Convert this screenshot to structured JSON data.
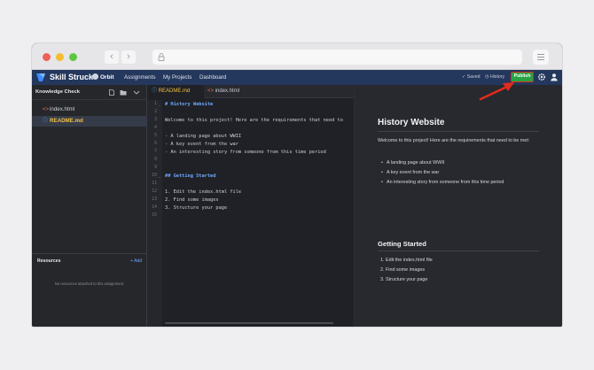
{
  "app": {
    "brand": "Skill Struck",
    "product": "Orbit",
    "nav": [
      "Assignments",
      "My Projects",
      "Dashboard"
    ],
    "saved": "✓ Saved",
    "history": "History",
    "publish": "Publish"
  },
  "sidebar": {
    "title": "Knowledge Check",
    "files": [
      {
        "name": "index.html",
        "icon": "code-icon"
      },
      {
        "name": "README.md",
        "icon": "info-icon",
        "active": true
      }
    ],
    "resources": {
      "title": "Resources",
      "add": "+ Add",
      "empty": "No resources attached to this assignment."
    }
  },
  "editor": {
    "tabs": [
      {
        "label": "README.md",
        "icon": "info-icon",
        "active": true
      },
      {
        "label": "index.html",
        "icon": "code-icon",
        "active": false
      }
    ],
    "line_numbers": [
      "1",
      "2",
      "3",
      "4",
      "5",
      "6",
      "7",
      "8",
      "9",
      "10",
      "11",
      "12",
      "13",
      "14",
      "15"
    ],
    "lines": [
      "# History Website",
      "",
      "Welcome to this project! Here are the requirements that need to",
      "",
      "- A landing page about WWII",
      "- A key event from the war",
      "- An interesting story from someone from this time period",
      "",
      "",
      "## Getting Started",
      "",
      "1. Edit the index.html file",
      "2. Find some images",
      "3. Structure your page",
      ""
    ]
  },
  "preview": {
    "title": "History Website",
    "intro": "Welcome to this project! Here are the requirements that need to be met:",
    "bullets": [
      "A landing page about WWII",
      "A key event from the war",
      "An interesting story from someone from this time period"
    ],
    "subtitle": "Getting Started",
    "steps": [
      "1. Edit the index.html file",
      "2. Find some images",
      "3. Structure your page"
    ]
  },
  "colors": {
    "header": "#24375c",
    "publish": "#27a243",
    "annotation": "#e02b1e",
    "active_tab": "#f0c14a"
  }
}
